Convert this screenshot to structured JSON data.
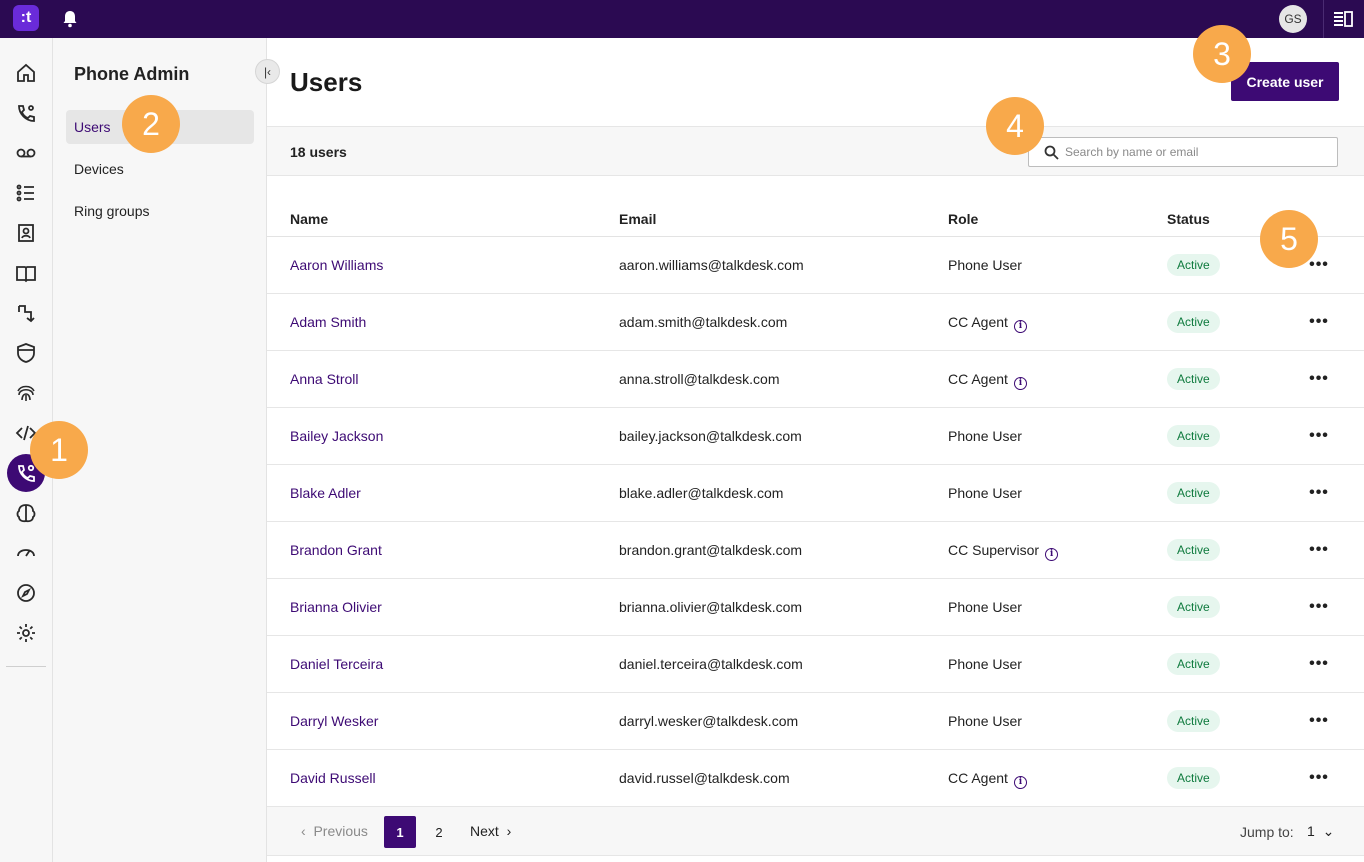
{
  "topbar": {
    "logo_text": ":t",
    "avatar_initials": "GS",
    "icons": [
      "bell-icon",
      "panel-toggle-icon"
    ]
  },
  "rail": {
    "items": [
      "home-icon",
      "phone-sparkle-icon",
      "voicemail-icon",
      "list-icon",
      "contacts-icon",
      "book-icon",
      "routing-icon",
      "shield-icon",
      "fingerprint-icon",
      "code-icon",
      "phone-admin-icon",
      "brain-icon",
      "gauge-icon",
      "compass-icon",
      "gear-icon"
    ],
    "active": "phone-admin-icon"
  },
  "subnav": {
    "title": "Phone Admin",
    "items": [
      {
        "label": "Users",
        "active": true
      },
      {
        "label": "Devices",
        "active": false
      },
      {
        "label": "Ring groups",
        "active": false
      }
    ]
  },
  "main": {
    "title": "Users",
    "create_label": "Create user",
    "count_label": "18 users",
    "search_placeholder": "Search by name or email"
  },
  "table": {
    "headers": [
      "Name",
      "Email",
      "Role",
      "Status"
    ],
    "rows": [
      {
        "name": "Aaron Williams",
        "email": "aaron.williams@talkdesk.com",
        "role": "Phone User",
        "role_info": false,
        "status": "Active"
      },
      {
        "name": "Adam Smith",
        "email": "adam.smith@talkdesk.com",
        "role": "CC Agent",
        "role_info": true,
        "status": "Active"
      },
      {
        "name": "Anna Stroll",
        "email": "anna.stroll@talkdesk.com",
        "role": "CC Agent",
        "role_info": true,
        "status": "Active"
      },
      {
        "name": "Bailey Jackson",
        "email": "bailey.jackson@talkdesk.com",
        "role": "Phone User",
        "role_info": false,
        "status": "Active"
      },
      {
        "name": "Blake Adler",
        "email": "blake.adler@talkdesk.com",
        "role": "Phone User",
        "role_info": false,
        "status": "Active"
      },
      {
        "name": "Brandon Grant",
        "email": "brandon.grant@talkdesk.com",
        "role": "CC Supervisor",
        "role_info": true,
        "status": "Active"
      },
      {
        "name": "Brianna Olivier",
        "email": "brianna.olivier@talkdesk.com",
        "role": "Phone User",
        "role_info": false,
        "status": "Active"
      },
      {
        "name": "Daniel Terceira",
        "email": "daniel.terceira@talkdesk.com",
        "role": "Phone User",
        "role_info": false,
        "status": "Active"
      },
      {
        "name": "Darryl Wesker",
        "email": "darryl.wesker@talkdesk.com",
        "role": "Phone User",
        "role_info": false,
        "status": "Active"
      },
      {
        "name": "David Russell",
        "email": "david.russel@talkdesk.com",
        "role": "CC Agent",
        "role_info": true,
        "status": "Active"
      }
    ]
  },
  "pagination": {
    "previous_label": "Previous",
    "pages": [
      "1",
      "2"
    ],
    "current_page": "1",
    "next_label": "Next",
    "jump_label": "Jump to:",
    "jump_value": "1"
  },
  "callouts": [
    "1",
    "2",
    "3",
    "4",
    "5"
  ],
  "colors": {
    "brand": "#3d0a74",
    "topbar": "#2b0a52",
    "callout": "#f8a94b",
    "status_active_bg": "#e6f6ee",
    "status_active_text": "#0e7a3d"
  }
}
